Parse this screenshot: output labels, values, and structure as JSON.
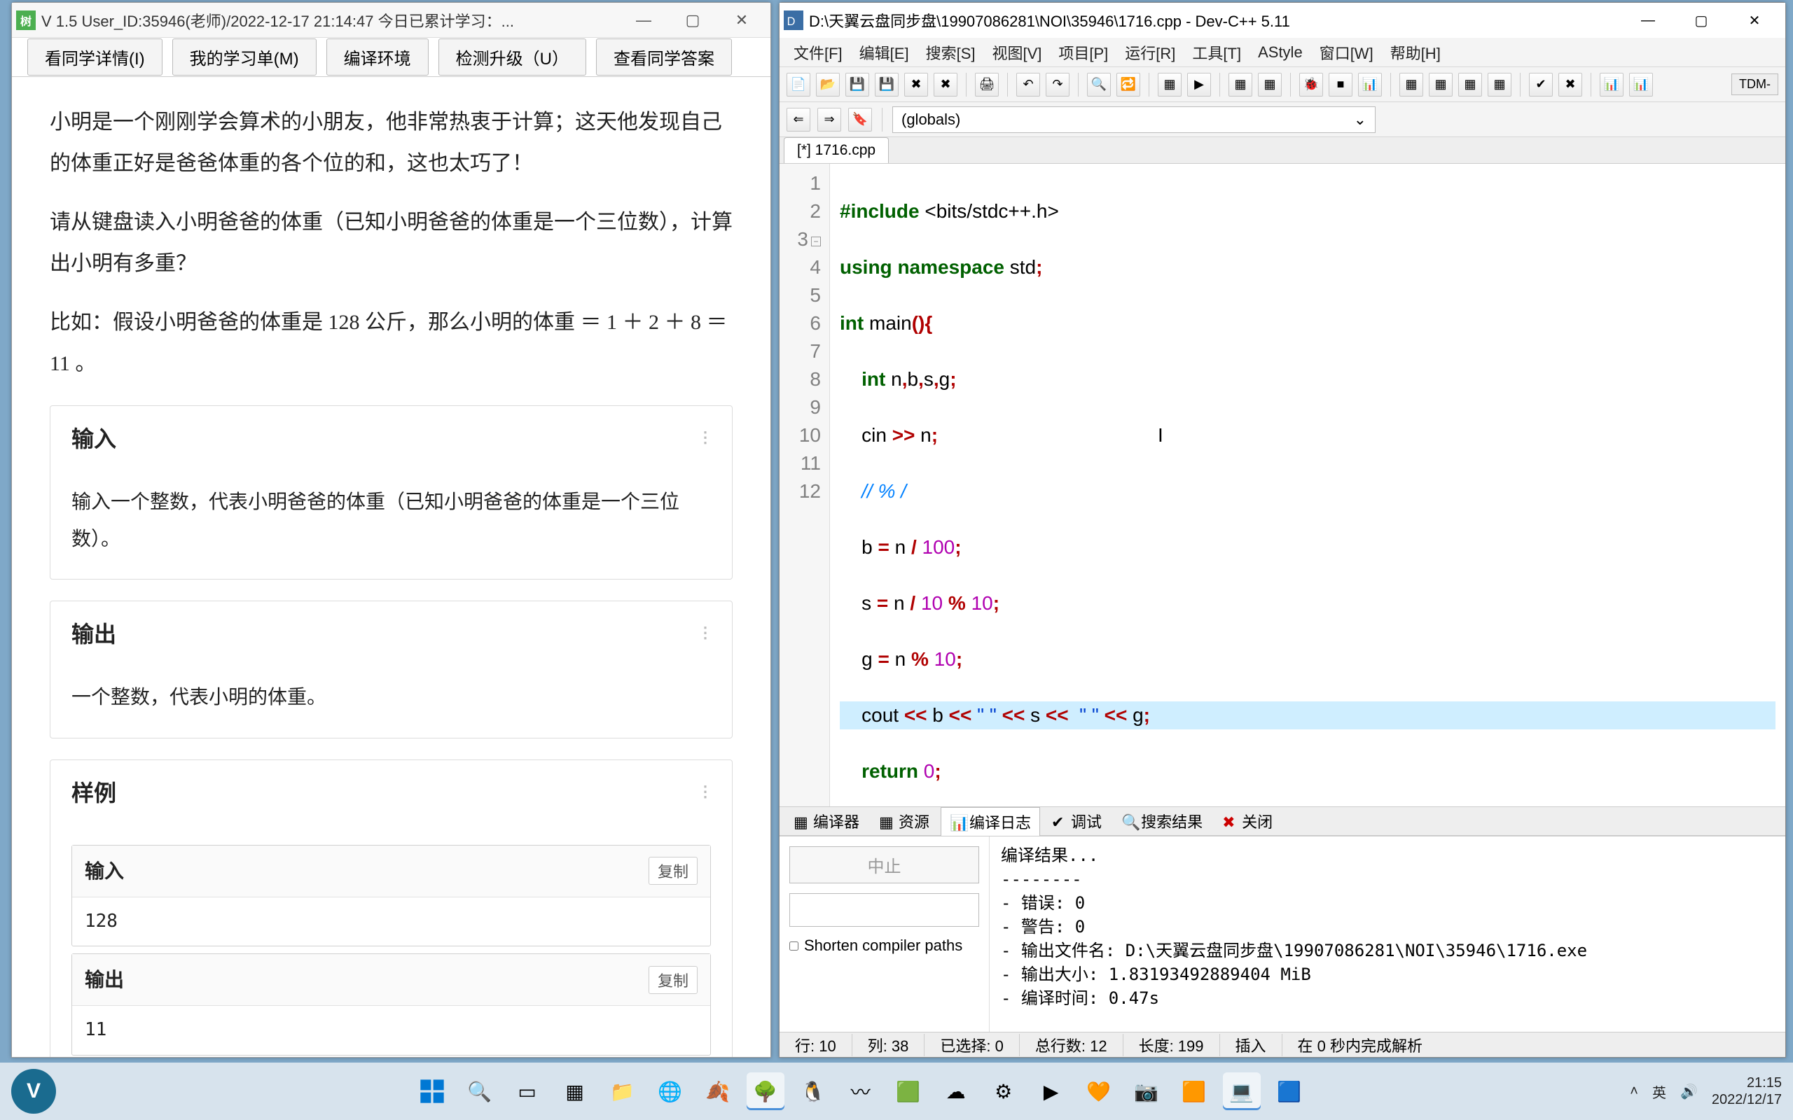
{
  "left": {
    "title": "V 1.5 User_ID:35946(老师)/2022-12-17 21:14:47 今日已累计学习：...",
    "tabs": [
      "看同学详情(I)",
      "我的学习单(M)",
      "编译环境",
      "检测升级（U）",
      "查看同学答案"
    ],
    "para1": "小明是一个刚刚学会算术的小朋友，他非常热衷于计算；这天他发现自己的体重正好是爸爸体重的各个位的和，这也太巧了！",
    "para2": "请从键盘读入小明爸爸的体重（已知小明爸爸的体重是一个三位数），计算出小明有多重？",
    "para3": "比如：假设小明爸爸的体重是 128 公斤，那么小明的体重 ＝ 1 ＋ 2 ＋ 8 ＝ 11 。",
    "sec_input_h": "输入",
    "sec_input_b": "输入一个整数，代表小明爸爸的体重（已知小明爸爸的体重是一个三位数）。",
    "sec_output_h": "输出",
    "sec_output_b": "一个整数，代表小明的体重。",
    "sec_sample_h": "样例",
    "io_in_h": "输入",
    "io_in_v": "128",
    "io_out_h": "输出",
    "io_out_v": "11",
    "copy": "复制"
  },
  "right": {
    "title": "D:\\天翼云盘同步盘\\19907086281\\NOI\\35946\\1716.cpp - Dev-C++ 5.11",
    "menu": [
      "文件[F]",
      "编辑[E]",
      "搜索[S]",
      "视图[V]",
      "项目[P]",
      "运行[R]",
      "工具[T]",
      "AStyle",
      "窗口[W]",
      "帮助[H]"
    ],
    "globals": "(globals)",
    "tdm": "TDM-",
    "tab": "[*] 1716.cpp",
    "lines": [
      "1",
      "2",
      "3",
      "4",
      "5",
      "6",
      "7",
      "8",
      "9",
      "10",
      "11",
      "12"
    ],
    "code": {
      "l1a": "#include",
      "l1b": " <bits/stdc++.h>",
      "l2a": "using",
      "l2b": " namespace",
      "l2c": " std",
      "l2d": ";",
      "l3a": "int",
      "l3b": " main",
      "l3c": "(){",
      "l4a": "    int",
      "l4b": " n",
      "l4c": ",",
      "l4d": "b",
      "l4e": ",",
      "l4f": "s",
      "l4g": ",",
      "l4h": "g",
      "l4i": ";",
      "l5a": "    cin ",
      "l5b": ">>",
      "l5c": " n",
      "l5d": ";",
      "l6": "    // % /",
      "l7a": "    b ",
      "l7b": "=",
      "l7c": " n ",
      "l7d": "/",
      "l7e": " ",
      "l7f": "100",
      "l7g": ";",
      "l8a": "    s ",
      "l8b": "=",
      "l8c": " n ",
      "l8d": "/",
      "l8e": " ",
      "l8f": "10",
      "l8g": " ",
      "l8h": "%",
      "l8i": " ",
      "l8j": "10",
      "l8k": ";",
      "l9a": "    g ",
      "l9b": "=",
      "l9c": " n ",
      "l9d": "%",
      "l9e": " ",
      "l9f": "10",
      "l9g": ";",
      "l10a": "    cout ",
      "l10b": "<<",
      "l10c": " b ",
      "l10d": "<<",
      "l10e": " ",
      "l10f": "\" \"",
      "l10g": " ",
      "l10h": "<<",
      "l10i": " s ",
      "l10j": "<<",
      "l10k": "  ",
      "l10l": "\" \"",
      "l10m": " ",
      "l10n": "<<",
      "l10o": " g",
      "l10p": ";",
      "l11a": "    return",
      "l11b": " ",
      "l11c": "0",
      "l11d": ";",
      "l12": "}"
    },
    "btabs": {
      "compiler": "编译器",
      "res": "资源",
      "log": "编译日志",
      "debug": "调试",
      "find": "搜索结果",
      "close": "关闭"
    },
    "abort": "中止",
    "shorten": "Shorten compiler paths",
    "out": "编译结果...\n--------\n- 错误: 0\n- 警告: 0\n- 输出文件名: D:\\天翼云盘同步盘\\19907086281\\NOI\\35946\\1716.exe\n- 输出大小: 1.83193492889404 MiB\n- 编译时间: 0.47s",
    "status": {
      "row": "行:    10",
      "col": "列:    38",
      "sel": "已选择:    0",
      "total": "总行数:    12",
      "len": "长度:    199",
      "ins": "插入",
      "done": "在 0 秒内完成解析"
    }
  },
  "taskbar": {
    "time": "21:15",
    "date": "2022/12/17"
  }
}
